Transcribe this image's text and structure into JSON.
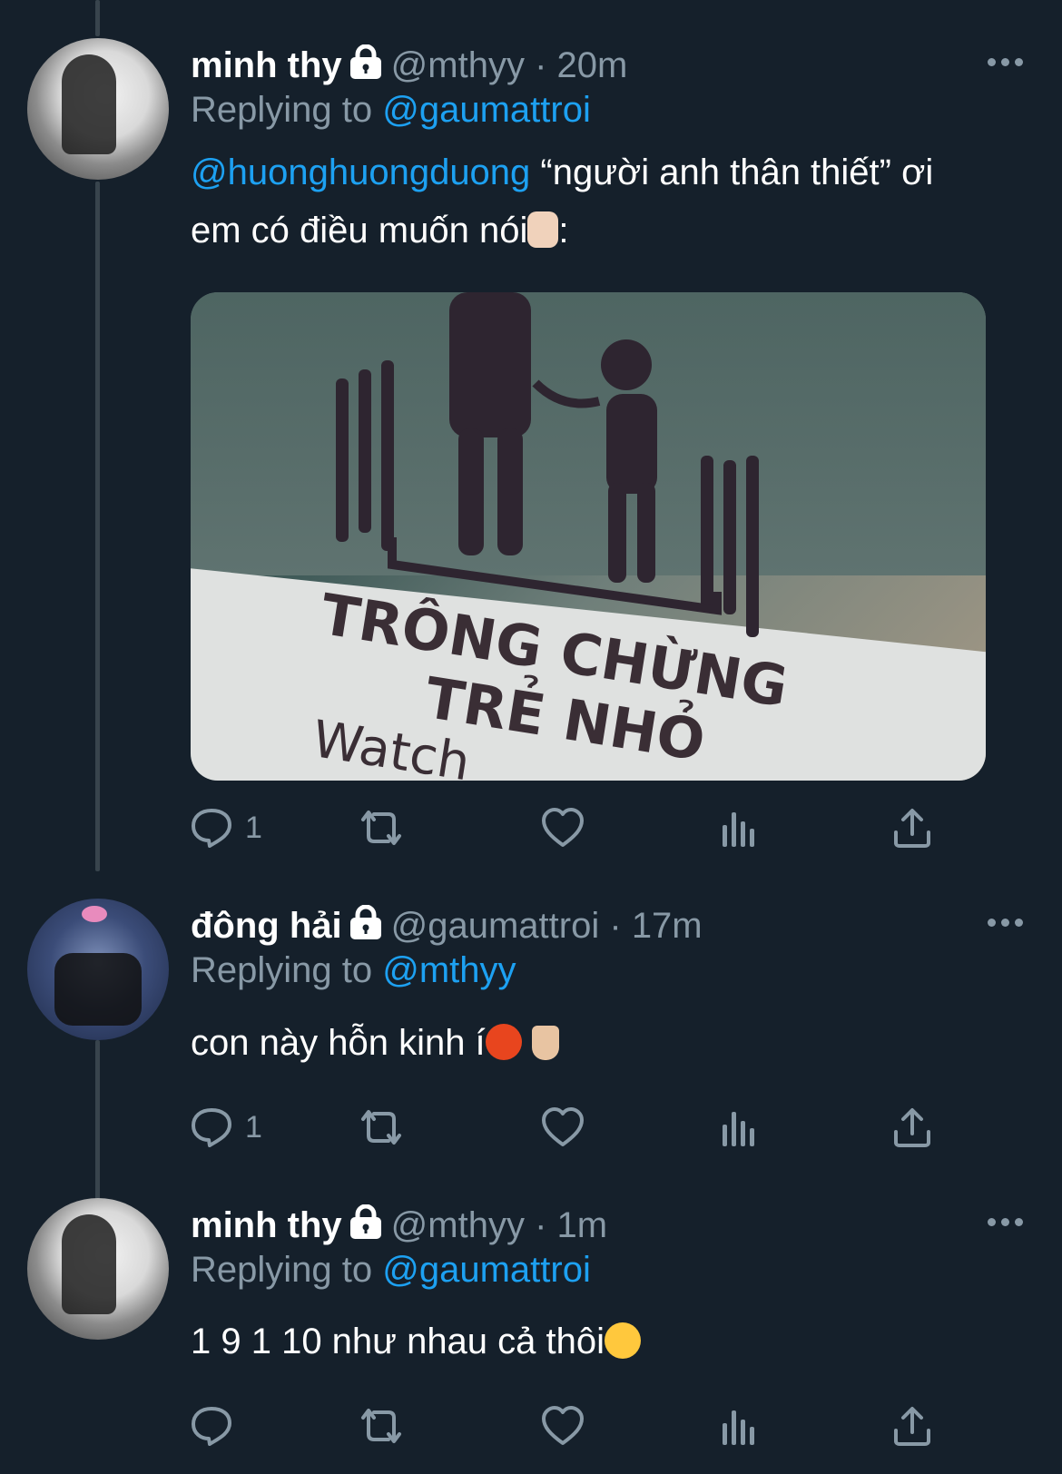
{
  "theme": {
    "background": "#15202b",
    "text": "#ffffff",
    "muted": "#8899a6",
    "link": "#1da1f2",
    "thread_line": "#38444d"
  },
  "tweets": [
    {
      "name": "minh thy",
      "handle": "@mthyy",
      "separator": "·",
      "time": "20m",
      "replying_prefix": "Replying to",
      "replying_to": "@gaumattroi",
      "mention": "@huonghuongduong",
      "text_line1": " “người anh thân thiết” ơi",
      "text_line2": "em có điều muốn nói",
      "text_line2_suffix": ":",
      "emoji": "person-gesturing-no",
      "media": {
        "sign_line1": "TRÔNG CHỪNG",
        "sign_line2": "TRẺ NHỎ",
        "sign_line3": "Watch"
      },
      "reply_count": "1"
    },
    {
      "name": "đông hải",
      "handle": "@gaumattroi",
      "separator": "·",
      "time": "17m",
      "replying_prefix": "Replying to",
      "replying_to": "@mthyy",
      "text": "con này hỗn kinh í",
      "emojis": [
        "angry-face",
        "middle-finger"
      ],
      "reply_count": "1"
    },
    {
      "name": "minh thy",
      "handle": "@mthyy",
      "separator": "·",
      "time": "1m",
      "replying_prefix": "Replying to",
      "replying_to": "@gaumattroi",
      "text": "1 9 1 10 như nhau cả thôi",
      "emoji": "heart-eyes-face",
      "reply_count": ""
    }
  ]
}
